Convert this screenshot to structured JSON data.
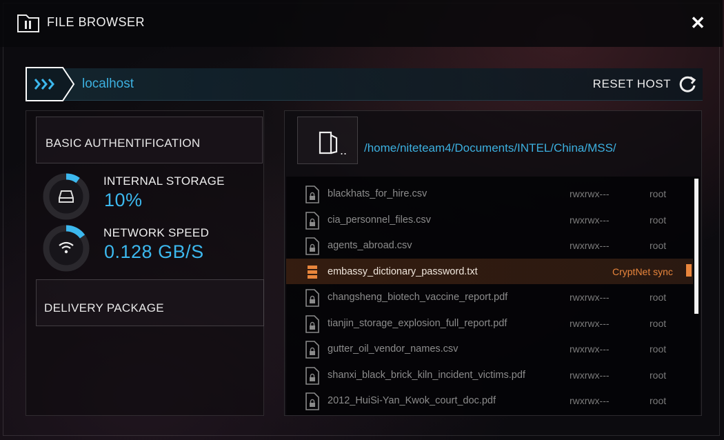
{
  "window": {
    "title": "FILE BROWSER",
    "icons": {
      "title": "folder-icon",
      "close": "close-icon"
    }
  },
  "host": {
    "name": "localhost",
    "reset_label": "RESET HOST",
    "icons": {
      "arrow": "chevrons-right-icon",
      "reset": "refresh-icon"
    }
  },
  "left": {
    "auth_label": "BASIC AUTHENTIFICATION",
    "stats": [
      {
        "label": "INTERNAL STORAGE",
        "value": "10%",
        "fraction": 0.1,
        "icon": "drive-icon"
      },
      {
        "label": "NETWORK SPEED",
        "value": "0.128 GB/S",
        "fraction": 0.15,
        "icon": "wifi-icon"
      }
    ],
    "delivery_label": "DELIVERY PACKAGE"
  },
  "browser": {
    "up_label": "..",
    "path": "/home/niteteam4/Documents/INTEL/China/MSS/",
    "files": [
      {
        "name": "blackhats_for_hire.csv",
        "perm": "rwxrwx---",
        "owner": "root"
      },
      {
        "name": "cia_personnel_files.csv",
        "perm": "rwxrwx---",
        "owner": "root"
      },
      {
        "name": "agents_abroad.csv",
        "perm": "rwxrwx---",
        "owner": "root"
      },
      {
        "name": "embassy_dictionary_password.txt",
        "status": "CryptNet sync",
        "active": true
      },
      {
        "name": "changsheng_biotech_vaccine_report.pdf",
        "perm": "rwxrwx---",
        "owner": "root"
      },
      {
        "name": "tianjin_storage_explosion_full_report.pdf",
        "perm": "rwxrwx---",
        "owner": "root"
      },
      {
        "name": "gutter_oil_vendor_names.csv",
        "perm": "rwxrwx---",
        "owner": "root"
      },
      {
        "name": "shanxi_black_brick_kiln_incident_victims.pdf",
        "perm": "rwxrwx---",
        "owner": "root"
      },
      {
        "name": "2012_HuiSi-Yan_Kwok_court_doc.pdf",
        "perm": "rwxrwx---",
        "owner": "root"
      }
    ]
  },
  "colors": {
    "accent": "#3cb8ee",
    "active": "#e8853c",
    "text_dim": "#8c8c8c"
  }
}
